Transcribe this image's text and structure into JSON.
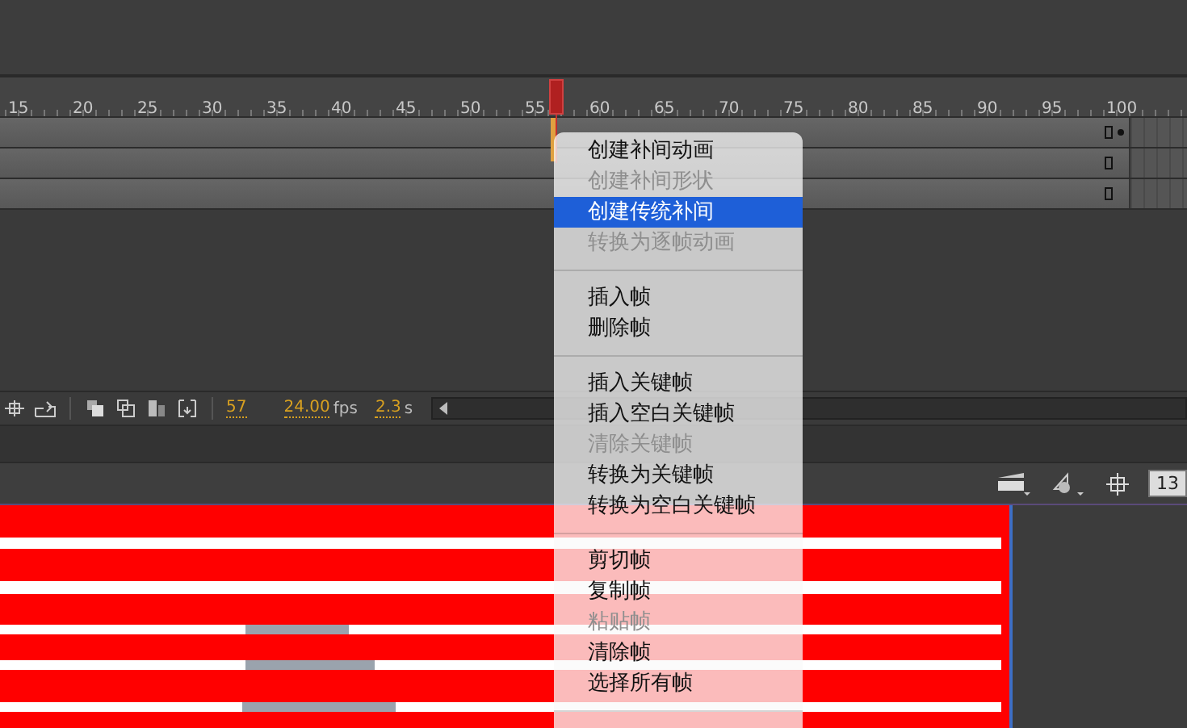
{
  "timeline": {
    "ruler_labels": [
      "15",
      "20",
      "25",
      "30",
      "35",
      "40",
      "45",
      "50",
      "55",
      "60",
      "65",
      "70",
      "75",
      "80",
      "85",
      "90",
      "95",
      "100"
    ],
    "layers": [
      {
        "has_dot": true
      },
      {
        "has_dot": false
      },
      {
        "has_dot": false
      }
    ],
    "status": {
      "current_frame": "57",
      "fps": "24.00",
      "fps_unit": "fps",
      "time": "2.3",
      "time_unit": "s"
    }
  },
  "stage_toolbar": {
    "zoom": "13"
  },
  "context_menu": [
    {
      "kind": "item",
      "label": "创建补间动画",
      "disabled": false,
      "selected": false
    },
    {
      "kind": "item",
      "label": "创建补间形状",
      "disabled": true,
      "selected": false
    },
    {
      "kind": "item",
      "label": "创建传统补间",
      "disabled": false,
      "selected": true
    },
    {
      "kind": "item",
      "label": "转换为逐帧动画",
      "disabled": true,
      "selected": false
    },
    {
      "kind": "separator"
    },
    {
      "kind": "item",
      "label": "插入帧",
      "disabled": false,
      "selected": false
    },
    {
      "kind": "item",
      "label": "删除帧",
      "disabled": false,
      "selected": false
    },
    {
      "kind": "separator"
    },
    {
      "kind": "item",
      "label": "插入关键帧",
      "disabled": false,
      "selected": false
    },
    {
      "kind": "item",
      "label": "插入空白关键帧",
      "disabled": false,
      "selected": false
    },
    {
      "kind": "item",
      "label": "清除关键帧",
      "disabled": true,
      "selected": false
    },
    {
      "kind": "item",
      "label": "转换为关键帧",
      "disabled": false,
      "selected": false
    },
    {
      "kind": "item",
      "label": "转换为空白关键帧",
      "disabled": false,
      "selected": false
    },
    {
      "kind": "separator"
    },
    {
      "kind": "item",
      "label": "剪切帧",
      "disabled": false,
      "selected": false
    },
    {
      "kind": "item",
      "label": "复制帧",
      "disabled": false,
      "selected": false
    },
    {
      "kind": "item",
      "label": "粘贴帧",
      "disabled": true,
      "selected": false
    },
    {
      "kind": "item",
      "label": "清除帧",
      "disabled": false,
      "selected": false
    },
    {
      "kind": "item",
      "label": "选择所有帧",
      "disabled": false,
      "selected": false
    },
    {
      "kind": "separator"
    }
  ]
}
